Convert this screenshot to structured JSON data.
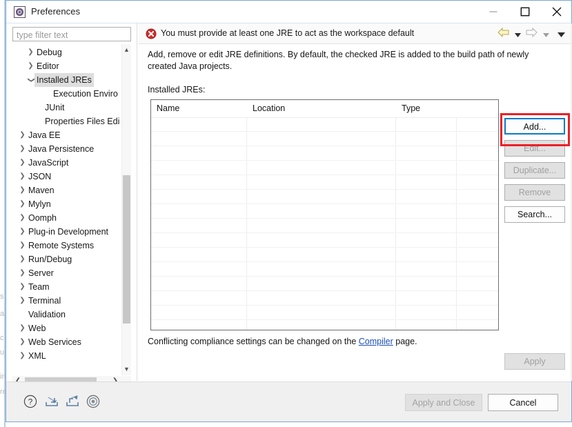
{
  "window": {
    "title": "Preferences",
    "icon": "preferences-icon",
    "controls": {
      "minimize": "minimize-icon",
      "maximize": "maximize-icon",
      "close": "close-icon"
    }
  },
  "left_pane": {
    "filter": {
      "placeholder": "type filter text",
      "value": ""
    },
    "tree": [
      {
        "label": "Debug",
        "indent": 1,
        "twisty": "collapsed",
        "selected": false
      },
      {
        "label": "Editor",
        "indent": 1,
        "twisty": "collapsed",
        "selected": false
      },
      {
        "label": "Installed JREs",
        "indent": 1,
        "twisty": "expanded",
        "selected": true
      },
      {
        "label": "Execution Enviro",
        "indent": 3,
        "twisty": "none",
        "selected": false
      },
      {
        "label": "JUnit",
        "indent": 2,
        "twisty": "none",
        "selected": false
      },
      {
        "label": "Properties Files Edi",
        "indent": 2,
        "twisty": "none",
        "selected": false
      },
      {
        "label": "Java EE",
        "indent": 0,
        "twisty": "collapsed",
        "selected": false
      },
      {
        "label": "Java Persistence",
        "indent": 0,
        "twisty": "collapsed",
        "selected": false
      },
      {
        "label": "JavaScript",
        "indent": 0,
        "twisty": "collapsed",
        "selected": false
      },
      {
        "label": "JSON",
        "indent": 0,
        "twisty": "collapsed",
        "selected": false
      },
      {
        "label": "Maven",
        "indent": 0,
        "twisty": "collapsed",
        "selected": false
      },
      {
        "label": "Mylyn",
        "indent": 0,
        "twisty": "collapsed",
        "selected": false
      },
      {
        "label": "Oomph",
        "indent": 0,
        "twisty": "collapsed",
        "selected": false
      },
      {
        "label": "Plug-in Development",
        "indent": 0,
        "twisty": "collapsed",
        "selected": false
      },
      {
        "label": "Remote Systems",
        "indent": 0,
        "twisty": "collapsed",
        "selected": false
      },
      {
        "label": "Run/Debug",
        "indent": 0,
        "twisty": "collapsed",
        "selected": false
      },
      {
        "label": "Server",
        "indent": 0,
        "twisty": "collapsed",
        "selected": false
      },
      {
        "label": "Team",
        "indent": 0,
        "twisty": "collapsed",
        "selected": false
      },
      {
        "label": "Terminal",
        "indent": 0,
        "twisty": "collapsed",
        "selected": false
      },
      {
        "label": "Validation",
        "indent": 0,
        "twisty": "none",
        "selected": false
      },
      {
        "label": "Web",
        "indent": 0,
        "twisty": "collapsed",
        "selected": false
      },
      {
        "label": "Web Services",
        "indent": 0,
        "twisty": "collapsed",
        "selected": false
      },
      {
        "label": "XML",
        "indent": 0,
        "twisty": "collapsed",
        "selected": false
      }
    ],
    "scrollbars": {
      "vertical_up": "scroll-up-icon",
      "vertical_down": "scroll-down-icon",
      "horizontal_left": "scroll-left-icon",
      "horizontal_right": "scroll-right-icon"
    }
  },
  "right_pane": {
    "message": {
      "icon": "error-icon",
      "text": "You must provide at least one JRE to act as the workspace default",
      "icon_color": "#d02b2b"
    },
    "nav": {
      "back": "back-arrow-icon",
      "back_menu": "back-dropdown-icon",
      "forward": "forward-arrow-icon",
      "forward_menu": "forward-dropdown-icon",
      "menu": "view-menu-icon"
    },
    "description": "Add, remove or edit JRE definitions. By default, the checked JRE is added to the build path of newly created Java projects.",
    "table_label": "Installed JREs:",
    "table": {
      "columns": [
        "Name",
        "Location",
        "Type",
        ""
      ],
      "rows": []
    },
    "buttons": [
      {
        "label": "Add...",
        "state": "focused"
      },
      {
        "label": "Edit...",
        "state": "disabled"
      },
      {
        "label": "Duplicate...",
        "state": "disabled"
      },
      {
        "label": "Remove",
        "state": "disabled"
      },
      {
        "label": "Search...",
        "state": "enabled"
      }
    ],
    "highlight": {
      "target": "Add...",
      "color": "#ec2027"
    },
    "compiler_note": {
      "prefix": "Conflicting compliance settings can be changed on the ",
      "link": "Compiler",
      "suffix": " page."
    },
    "apply_button": {
      "label": "Apply",
      "state": "disabled"
    }
  },
  "bottom_bar": {
    "icons": [
      {
        "name": "help-icon",
        "glyph": "?"
      },
      {
        "name": "import-icon",
        "glyph": "import"
      },
      {
        "name": "export-icon",
        "glyph": "export"
      },
      {
        "name": "record-icon",
        "glyph": "record"
      }
    ],
    "buttons": [
      {
        "label": "Apply and Close",
        "state": "disabled"
      },
      {
        "label": "Cancel",
        "state": "normal"
      }
    ]
  },
  "background_window": {
    "ghost_lines": [
      "s",
      "a",
      "c",
      "u",
      "in",
      "re"
    ]
  },
  "colors": {
    "accent_focus": "#0a7ac6",
    "highlight_red": "#ec2027",
    "link_blue": "#1a4fb8",
    "selection_gray": "#dedede",
    "window_border": "#7aa7cf"
  }
}
